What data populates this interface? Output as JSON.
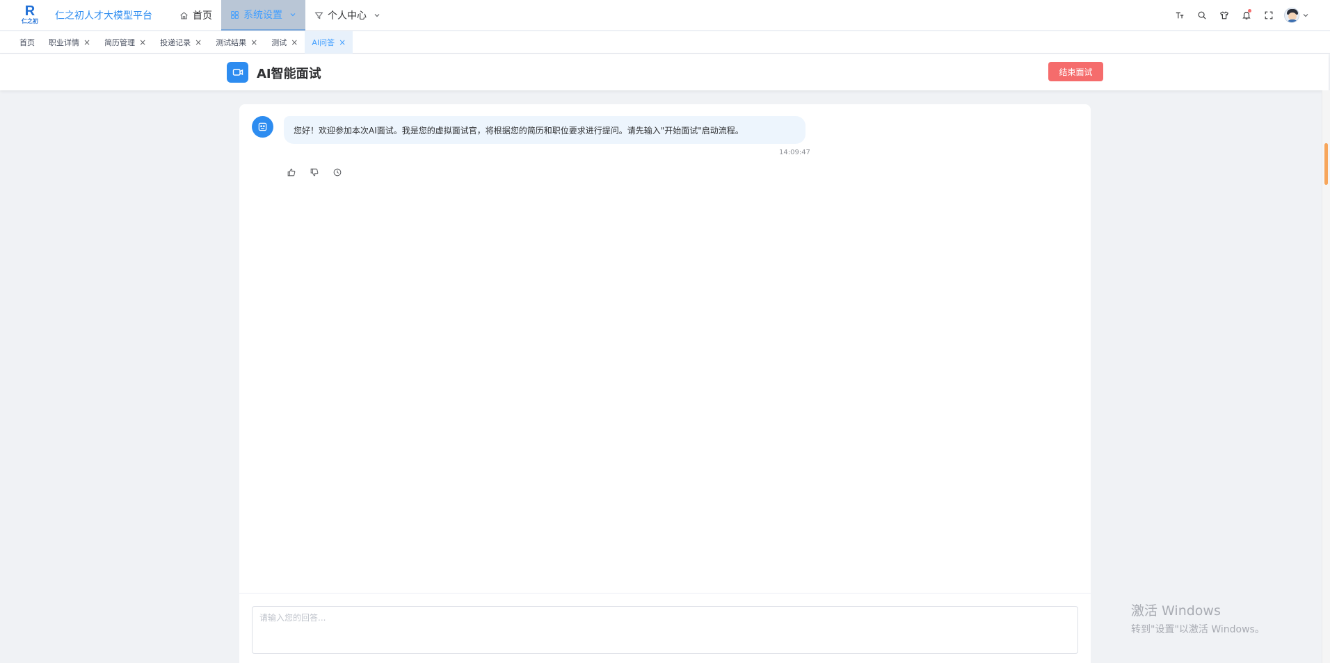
{
  "navbar": {
    "logo_text": "仁之初",
    "app_title": "仁之初人才大模型平台",
    "menu": [
      {
        "label": "首页",
        "icon": "home-icon",
        "active": false
      },
      {
        "label": "系统设置",
        "icon": "grid-icon",
        "active": true
      },
      {
        "label": "个人中心",
        "icon": "filter-icon",
        "active": false
      }
    ],
    "tools": [
      "font-size-icon",
      "search-icon",
      "theme-shirt-icon",
      "bell-icon",
      "fullscreen-icon"
    ]
  },
  "tags": [
    {
      "label": "首页",
      "closable": false,
      "active": false
    },
    {
      "label": "职业详情",
      "closable": true,
      "active": false
    },
    {
      "label": "简历管理",
      "closable": true,
      "active": false
    },
    {
      "label": "投递记录",
      "closable": true,
      "active": false
    },
    {
      "label": "测试结果",
      "closable": true,
      "active": false
    },
    {
      "label": "测试",
      "closable": true,
      "active": false
    },
    {
      "label": "AI问答",
      "closable": true,
      "active": true
    }
  ],
  "header": {
    "title": "AI智能面试",
    "end_button": "结束面试"
  },
  "chat": {
    "messages": [
      {
        "role": "bot",
        "text": "您好！欢迎参加本次AI面试。我是您的虚拟面试官，将根据您的简历和职位要求进行提问。请先输入\"开始面试\"启动流程。",
        "time": "14:09:47"
      }
    ],
    "input_placeholder": "请输入您的回答..."
  },
  "watermark": {
    "title": "激活 Windows",
    "subtitle": "转到\"设置\"以激活 Windows。"
  },
  "colors": {
    "accent": "#2d8cf0",
    "danger": "#f56c6c",
    "active_menu_bg": "#b9c6d6"
  }
}
